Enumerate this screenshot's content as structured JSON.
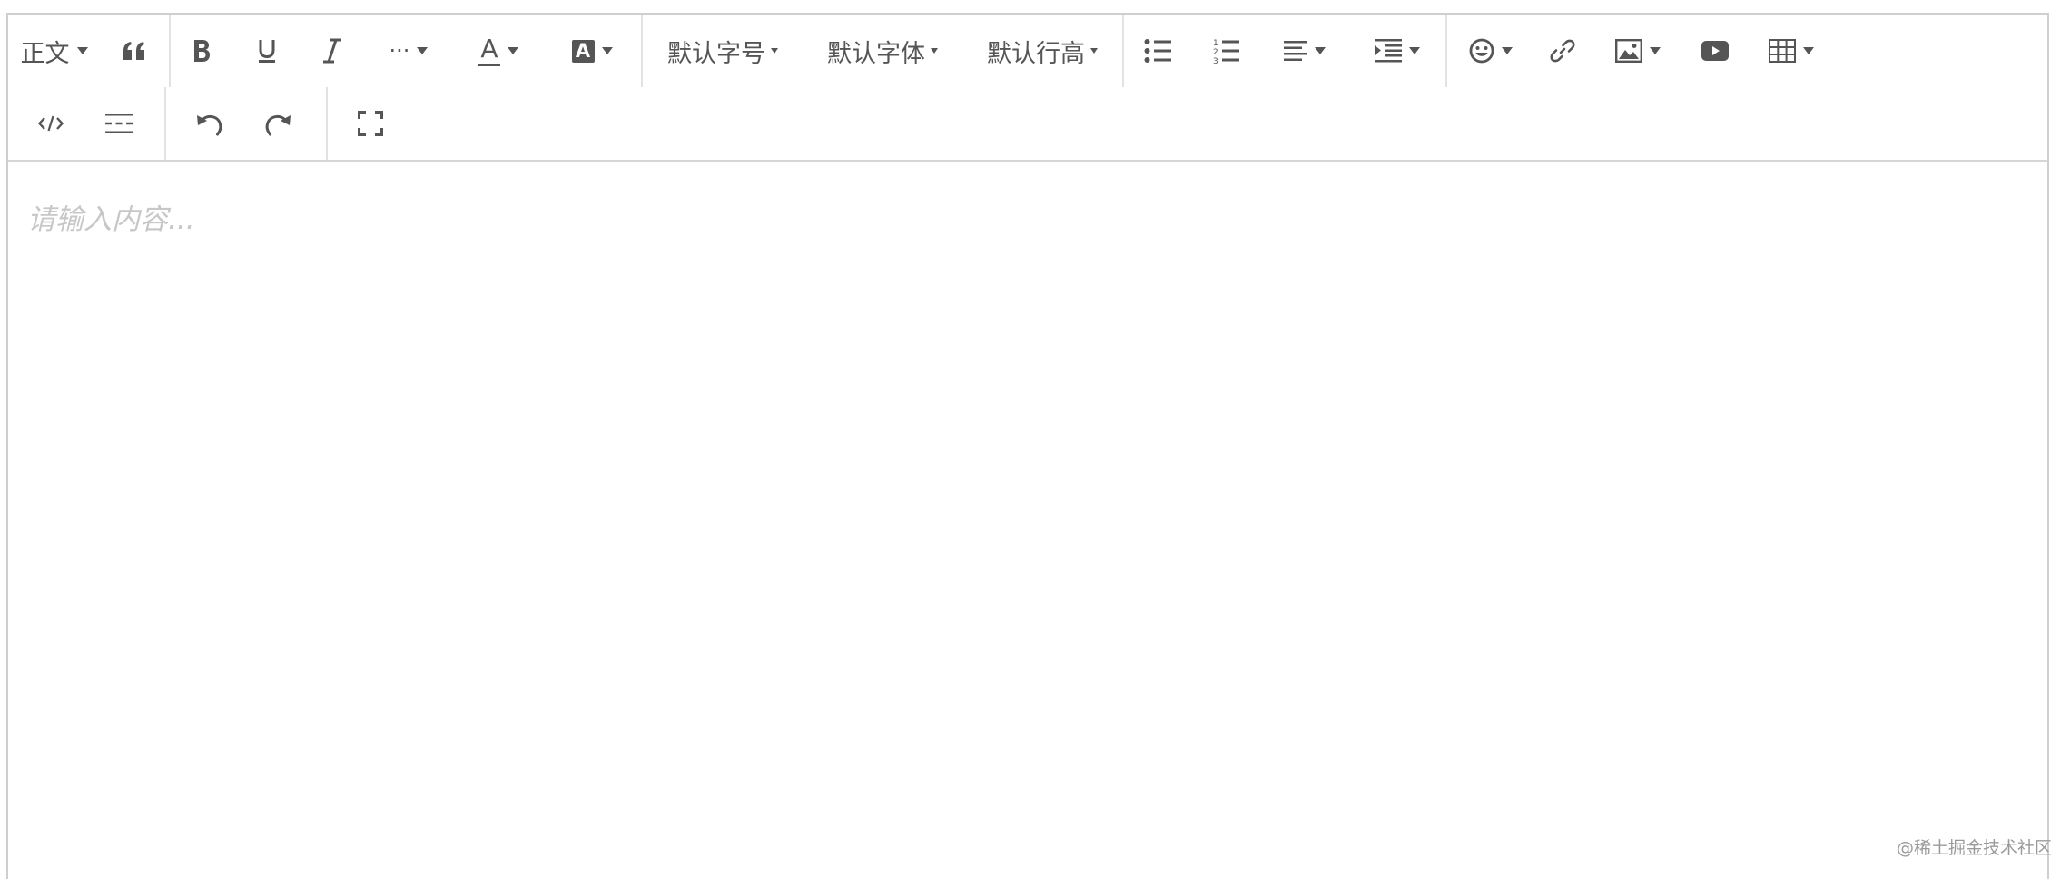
{
  "toolbar": {
    "heading_label": "正文",
    "font_size_label": "默认字号",
    "font_family_label": "默认字体",
    "line_height_label": "默认行高",
    "more_label": "···",
    "font_color_letter": "A",
    "bg_color_letter": "A",
    "icons": [
      "quote-icon",
      "bold-icon",
      "underline-icon",
      "italic-icon",
      "more-icon",
      "font-color-icon",
      "bg-color-icon",
      "bullet-list-icon",
      "numbered-list-icon",
      "align-icon",
      "indent-icon",
      "emoji-icon",
      "link-icon",
      "image-icon",
      "video-icon",
      "table-icon",
      "code-icon",
      "divider-icon",
      "undo-icon",
      "redo-icon",
      "fullscreen-icon"
    ]
  },
  "editor": {
    "placeholder": "请输入内容..."
  },
  "watermark": "@稀土掘金技术社区",
  "colors": {
    "icon": "#555555",
    "border": "#cfcfcf",
    "placeholder": "#c7c7c7"
  }
}
